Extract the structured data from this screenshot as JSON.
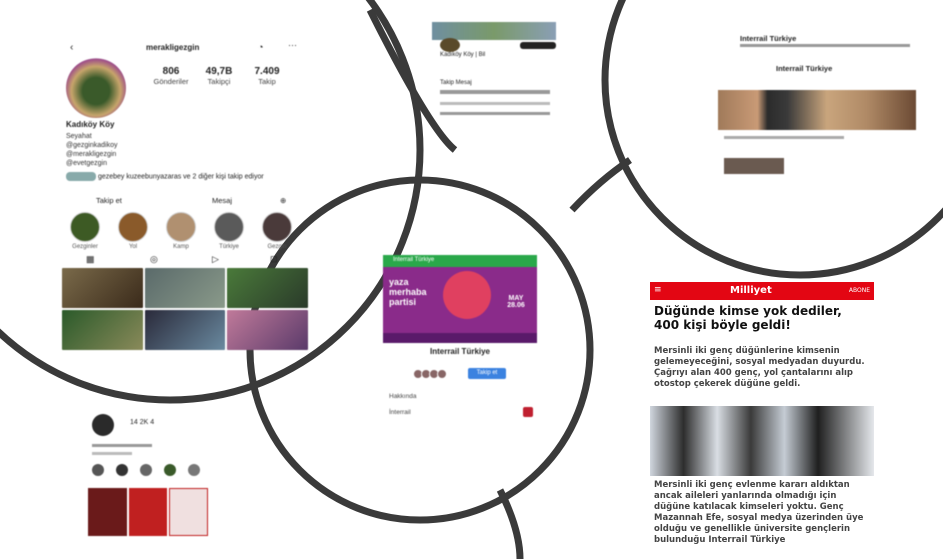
{
  "instagram_profile": {
    "username": "merakligezgin",
    "stats": [
      {
        "num": "806",
        "label": "Gönderiler"
      },
      {
        "num": "49,7B",
        "label": "Takipçi"
      },
      {
        "num": "7.409",
        "label": "Takip"
      }
    ],
    "display_name": "Kadıköy Köy",
    "bio_lines": [
      "Seyahat",
      "@gezginkadikoy",
      "@merakligezgin",
      "@evetgezgin"
    ],
    "follow_note": "gezebey kuzeebunyazaras ve 2 diğer kişi takip ediyor",
    "tab_labels": [
      "Takip et",
      "Mesaj"
    ],
    "highlights": [
      "Gezginler",
      "Yol",
      "Kamp",
      "Türkiye",
      "Gezgin"
    ]
  },
  "top_profile": {
    "name": "Kadıköy Köy | Bil",
    "row1": "Takip   Mesaj"
  },
  "interrail_video": {
    "header": "Interrail Türkiye",
    "subtitle": "Interrail Türkiye"
  },
  "interrail_center": {
    "header": "Interrail Türkiye",
    "poster_title": "yaza merhaba partisi",
    "poster_date": "MAY 28.06",
    "name": "Interrail Türkiye",
    "follow_label": "Takip et",
    "row1": "Hakkında",
    "row2": "İnterrail"
  },
  "milliyet": {
    "logo": "Milliyet",
    "menu": "≡",
    "subscribe": "ABONE",
    "headline": "Düğünde kimse yok dediler, 400 kişi böyle geldi!",
    "lead": "Mersinli iki genç düğünlerine kimsenin gelemeyeceğini, sosyal medyadan duyurdu. Çağrıyı alan 400 genç, yol çantalarını alıp otostop çekerek düğüne geldi.",
    "body": "Mersinli iki genç evlenme kararı aldıktan ancak aileleri yanlarında olmadığı için düğüne katılacak kimseleri yoktu. Genç Mazannah Efe, sosyal medya üzerinden üye olduğu ve genellikle üniversite gençlerin bulunduğu Interrail Türkiye"
  },
  "small_profile": {
    "stats": "14  2K  4"
  },
  "colors": {
    "ring_stroke": "#3a3a3a",
    "milliyet_red": "#e30613",
    "interrail_green": "#2aa84a",
    "poster_purple": "#8a2b8a",
    "follow_blue": "#3b82e0"
  }
}
